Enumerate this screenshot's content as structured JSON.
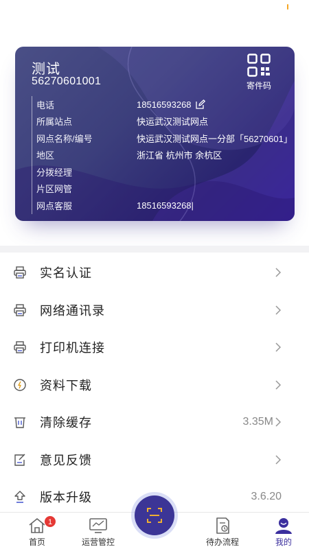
{
  "card": {
    "name": "测试",
    "id": "56270601001",
    "qr_label": "寄件码",
    "rows": [
      {
        "key": "电话",
        "value": "18516593268",
        "has_edit": true
      },
      {
        "key": "所属站点",
        "value": "快运武汉测试网点"
      },
      {
        "key": "网点名称/编号",
        "value": "快运武汉测试网点一分部「56270601」"
      },
      {
        "key": "地区",
        "value": "浙江省 杭州市 余杭区"
      },
      {
        "key": "分拨经理",
        "value": ""
      },
      {
        "key": "片区网管",
        "value": ""
      },
      {
        "key": "网点客服",
        "value": "18516593268|"
      }
    ]
  },
  "menu": [
    {
      "label": "实名认证",
      "icon": "printer-icon",
      "value": ""
    },
    {
      "label": "网络通讯录",
      "icon": "printer-icon",
      "value": ""
    },
    {
      "label": "打印机连接",
      "icon": "printer-icon",
      "value": ""
    },
    {
      "label": "资料下载",
      "icon": "download-circle-icon",
      "value": ""
    },
    {
      "label": "清除缓存",
      "icon": "trash-icon",
      "value": "3.35M"
    },
    {
      "label": "意见反馈",
      "icon": "feedback-icon",
      "value": ""
    },
    {
      "label": "版本升级",
      "icon": "upgrade-icon",
      "value": "3.6.20"
    }
  ],
  "tabbar": {
    "home": "首页",
    "home_badge": "1",
    "ops": "运营管控",
    "todo": "待办流程",
    "mine": "我的"
  },
  "colors": {
    "accent": "#3c3596",
    "badge": "#e53935",
    "icon_blue": "#4a5bd0",
    "status_orange": "#f5a623"
  }
}
